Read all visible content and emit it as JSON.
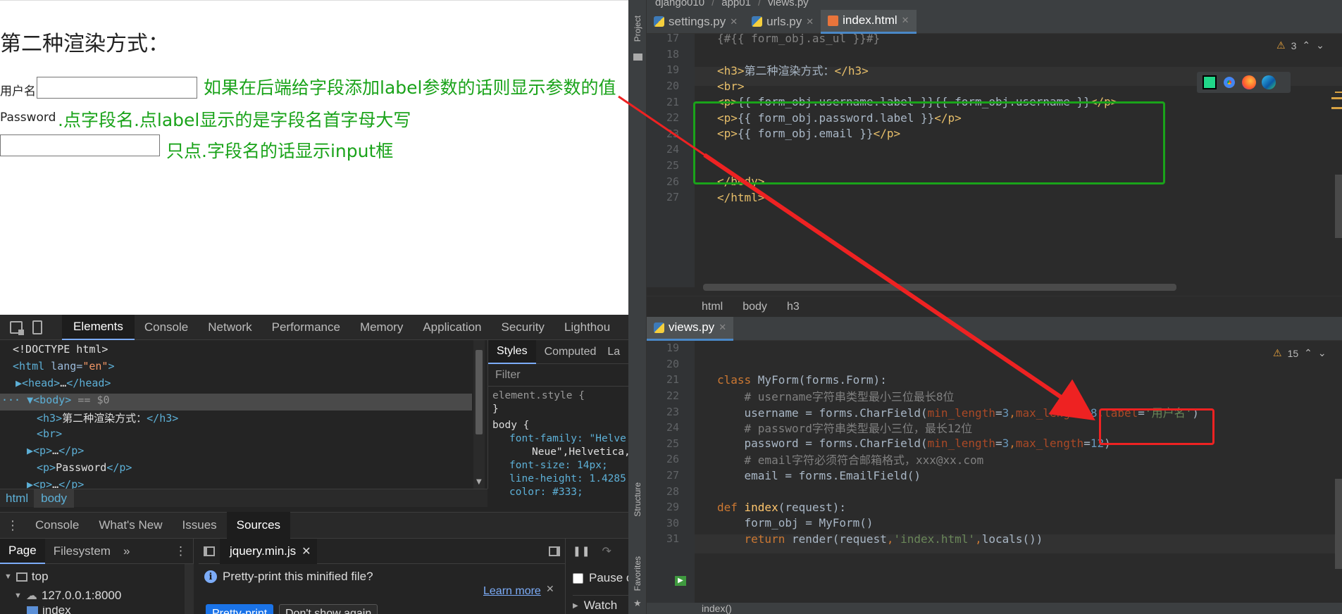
{
  "page": {
    "heading": "第二种渲染方式：",
    "username_label": "用户名",
    "password_label": "Password",
    "annotation_label_param": "如果在后端给字段添加label参数的话则显示参数的值",
    "annotation_default_label": ".点字段名.点label显示的是字段名首字母大写",
    "annotation_input_only": "只点.字段名的话显示input框"
  },
  "devtools": {
    "tabs": [
      "Elements",
      "Console",
      "Network",
      "Performance",
      "Memory",
      "Application",
      "Security",
      "Lighthou"
    ],
    "active_tab": "Elements",
    "dom": [
      {
        "indent": 0,
        "tag_open": "<!DOCTYPE html>",
        "text": "",
        "close": ""
      },
      {
        "indent": 0,
        "tag_open": "<html",
        "attr": " lang=",
        "val": "\"en\"",
        "close": ">"
      },
      {
        "indent": 1,
        "tag_open": "▶<head>",
        "text": "…",
        "close": "</head>"
      },
      {
        "indent": 0,
        "tag_open": "··· ▼<body>",
        "text": " == $0",
        "close": ""
      },
      {
        "indent": 2,
        "tag_open": "<h3>",
        "text": "第二种渲染方式：",
        "close": "</h3>"
      },
      {
        "indent": 2,
        "tag_open": "<br>",
        "text": "",
        "close": ""
      },
      {
        "indent": 2,
        "tag_open": "▶<p>",
        "text": "…",
        "close": "</p>"
      },
      {
        "indent": 2,
        "tag_open": "<p>",
        "text": "Password",
        "close": "</p>"
      },
      {
        "indent": 2,
        "tag_open": "▶<p>",
        "text": "…",
        "close": "</p>"
      }
    ],
    "styles_tabs": [
      "Styles",
      "Computed",
      "La"
    ],
    "filter_placeholder": "Filter",
    "styles_lines": [
      "element.style {",
      "}",
      "body {",
      "font-family: \"Helve",
      "Neue\",Helvetica,",
      "font-size: 14px;",
      "line-height: 1.4285",
      "color: #333;"
    ],
    "breadcrumbs": [
      "html",
      "body"
    ],
    "drawer_tabs": [
      "Console",
      "What's New",
      "Issues",
      "Sources"
    ],
    "drawer_active": "Sources",
    "sources": {
      "left_tabs": [
        "Page",
        "Filesystem"
      ],
      "tree": [
        "top",
        "127.0.0.1:8000",
        "index"
      ],
      "open_file": "jquery.min.js",
      "pretty_msg": "Pretty-print this minified file?",
      "learn_more": "Learn more",
      "pretty_btn": "Pretty-print",
      "dont_show_btn": "Don't show again",
      "pause_label": "Pause o",
      "watch_label": "Watch"
    }
  },
  "ide": {
    "title_crumbs": [
      "django010",
      "app01",
      "views.py"
    ],
    "side_labels": [
      "Project",
      "Structure",
      "Favorites"
    ],
    "editor1": {
      "tabs": [
        "settings.py",
        "urls.py",
        "index.html"
      ],
      "active_tab": "index.html",
      "warnings": "3",
      "lines": [
        {
          "n": "17",
          "parts": [
            [
              "c-cmt",
              "{#{{ form_obj.as_ul }}#}"
            ]
          ]
        },
        {
          "n": "18",
          "parts": []
        },
        {
          "n": "19",
          "parts": [
            [
              "c-tag",
              "<h3>"
            ],
            [
              "c-tpl",
              "第二种渲染方式："
            ],
            [
              "c-tag",
              "</h3>"
            ]
          ]
        },
        {
          "n": "20",
          "parts": [
            [
              "c-tag",
              "<br>"
            ]
          ]
        },
        {
          "n": "21",
          "parts": [
            [
              "c-tag",
              "<p>"
            ],
            [
              "c-tpl",
              "{{ form_obj.username.label }}{{ form_obj.username }}"
            ],
            [
              "c-tag",
              "</p>"
            ]
          ]
        },
        {
          "n": "22",
          "parts": [
            [
              "c-tag",
              "<p>"
            ],
            [
              "c-tpl",
              "{{ form_obj.password.label }}"
            ],
            [
              "c-tag",
              "</p>"
            ]
          ]
        },
        {
          "n": "23",
          "parts": [
            [
              "c-tag",
              "<p>"
            ],
            [
              "c-tpl",
              "{{ form_obj.email }}"
            ],
            [
              "c-tag",
              "</p>"
            ]
          ]
        },
        {
          "n": "24",
          "parts": []
        },
        {
          "n": "25",
          "parts": []
        },
        {
          "n": "26",
          "parts": [
            [
              "c-tag",
              "</body>"
            ]
          ]
        },
        {
          "n": "27",
          "parts": [
            [
              "c-tag",
              "</html>"
            ]
          ]
        }
      ],
      "crumbs": [
        "html",
        "body",
        "h3"
      ]
    },
    "editor2": {
      "tabs": [
        "views.py"
      ],
      "warnings": "15",
      "lines": [
        {
          "n": "19",
          "parts": []
        },
        {
          "n": "20",
          "parts": []
        },
        {
          "n": "21",
          "parts": [
            [
              "c-kw",
              "class "
            ],
            [
              "c-tpl",
              "MyForm(forms.Form):"
            ]
          ]
        },
        {
          "n": "22",
          "parts": [
            [
              "c-cmt",
              "    # username字符串类型最小三位最长8位"
            ]
          ]
        },
        {
          "n": "23",
          "parts": [
            [
              "c-tpl",
              "    username = forms.CharField("
            ],
            [
              "c-param",
              "min_length"
            ],
            [
              "c-tpl",
              "="
            ],
            [
              "c-num",
              "3"
            ],
            [
              "c-kw",
              ","
            ],
            [
              "c-param",
              "max_length"
            ],
            [
              "c-tpl",
              "="
            ],
            [
              "c-num",
              "8"
            ],
            [
              "c-kw",
              ","
            ],
            [
              "c-param",
              "label"
            ],
            [
              "c-tpl",
              "="
            ],
            [
              "c-str",
              "'用户名'"
            ],
            [
              "c-tpl",
              ")"
            ]
          ]
        },
        {
          "n": "24",
          "parts": [
            [
              "c-cmt",
              "    # password字符串类型最小三位，最长12位"
            ]
          ]
        },
        {
          "n": "25",
          "parts": [
            [
              "c-tpl",
              "    password = forms.CharField("
            ],
            [
              "c-param",
              "min_length"
            ],
            [
              "c-tpl",
              "="
            ],
            [
              "c-num",
              "3"
            ],
            [
              "c-kw",
              ","
            ],
            [
              "c-param",
              "max_length"
            ],
            [
              "c-tpl",
              "="
            ],
            [
              "c-num",
              "12"
            ],
            [
              "c-tpl",
              ")"
            ]
          ]
        },
        {
          "n": "26",
          "parts": [
            [
              "c-cmt",
              "    # email字符必须符合邮箱格式，xxx@xx.com"
            ]
          ]
        },
        {
          "n": "27",
          "parts": [
            [
              "c-tpl",
              "    email = forms.EmailField()"
            ]
          ]
        },
        {
          "n": "28",
          "parts": []
        },
        {
          "n": "29",
          "parts": [
            [
              "c-kw",
              "def "
            ],
            [
              "c-fn",
              "index"
            ],
            [
              "c-tpl",
              "(request):"
            ]
          ]
        },
        {
          "n": "30",
          "parts": [
            [
              "c-tpl",
              "    form_obj = MyForm()"
            ]
          ]
        },
        {
          "n": "31",
          "parts": [
            [
              "c-kw",
              "    return "
            ],
            [
              "c-tpl",
              "render(request"
            ],
            [
              "c-kw",
              ","
            ],
            [
              "c-str",
              "'index.html'"
            ],
            [
              "c-kw",
              ","
            ],
            [
              "c-tpl",
              "locals())"
            ]
          ]
        }
      ],
      "status": "index()"
    }
  },
  "colors": {
    "annotation_green": "#1aa31a",
    "annotation_red": "#ee2222",
    "devtools_accent": "#7cacf8"
  }
}
